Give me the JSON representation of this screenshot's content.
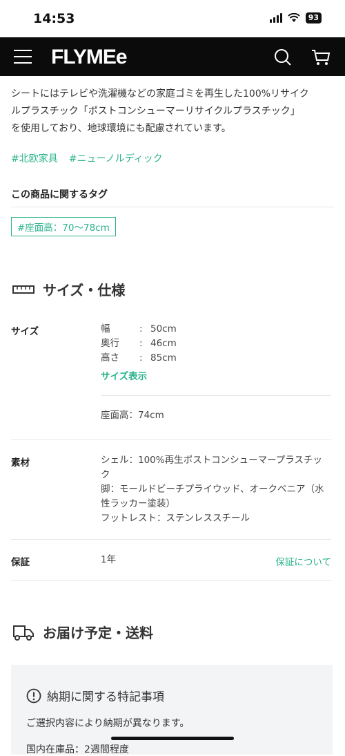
{
  "status": {
    "time": "14:53",
    "battery": "93"
  },
  "header": {
    "logo": "FLYMEe"
  },
  "description": {
    "line1": "シートにはテレビや洗濯機などの家庭ゴミを再生した100%リサイク",
    "line2": "ルプラスチック「ポストコンシューマーリサイクルプラスチック」",
    "line3": "を使用しており、地球環境にも配慮されています。"
  },
  "hashtags": [
    "#北欧家具",
    "#ニューノルディック"
  ],
  "tags": {
    "heading": "この商品に関するタグ",
    "chip": "#座面高：70〜78cm"
  },
  "spec": {
    "title": "サイズ・仕様",
    "size": {
      "label": "サイズ",
      "dims": [
        {
          "key": "幅",
          "sep": ":",
          "value": "50cm"
        },
        {
          "key": "奥行",
          "sep": ":",
          "value": "46cm"
        },
        {
          "key": "高さ",
          "sep": ":",
          "value": "85cm"
        }
      ],
      "link": "サイズ表示",
      "seat_height": "座面高：74cm"
    },
    "material": {
      "label": "素材",
      "line1": "シェル：100%再生ポストコンシューマープラスチッ",
      "line2": "ク",
      "line3": "脚：モールドビーチプライウッド、オークベニア（水",
      "line4": "性ラッカー塗装）",
      "line5": "フットレスト：ステンレススチール"
    },
    "warranty": {
      "label": "保証",
      "value": "1年",
      "link": "保証について"
    }
  },
  "delivery": {
    "title": "お届け予定・送料",
    "notice_title": "納期に関する特記事項",
    "notice_text": "ご選択内容により納期が異なります。",
    "notice_text2": "国内在庫品：2週間程度"
  },
  "colors": {
    "accent": "#2bb38c",
    "header_bg": "#0b0b0b"
  }
}
